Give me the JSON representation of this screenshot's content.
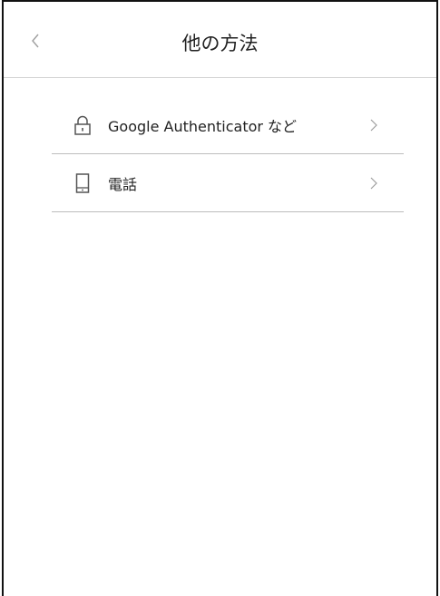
{
  "header": {
    "title": "他の方法",
    "back_icon": "chevron-left-icon"
  },
  "options": [
    {
      "label": "Google Authenticator など",
      "icon": "lock-icon"
    },
    {
      "label": "電話",
      "icon": "phone-icon"
    }
  ],
  "colors": {
    "text": "#222222",
    "divider": "#bdbdbd",
    "icon": "#555555",
    "chevron": "#9e9e9e"
  }
}
